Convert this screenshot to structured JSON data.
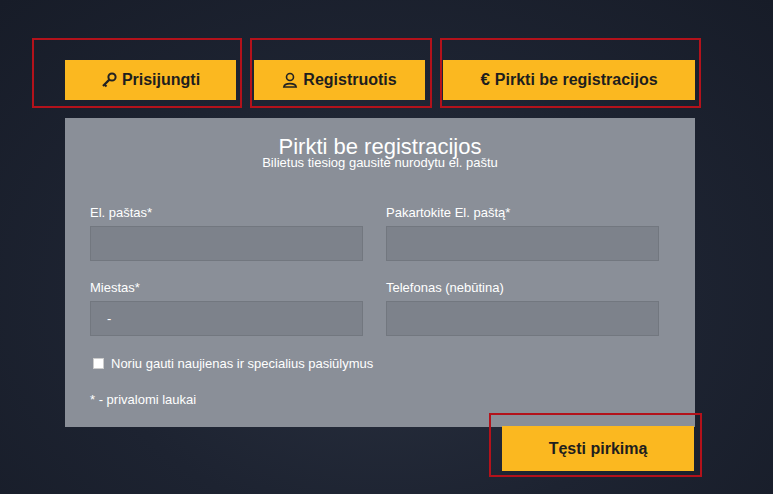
{
  "auth_buttons": [
    {
      "kind": "key",
      "label": "Prisijungti",
      "highlighted": true
    },
    {
      "kind": "user",
      "label": "Registruotis",
      "highlighted": true
    },
    {
      "kind": "glyph",
      "glyph": "€",
      "label": "Pirkti be registracijos",
      "highlighted": true
    }
  ],
  "form": {
    "title": "Pirkti be registracijos",
    "subtitle": "Bilietus tiesiog gausite nurodytu el. paštu",
    "fields": [
      {
        "label": "El. paštas*",
        "value": ""
      },
      {
        "label": "Pakartokite El. paštą*",
        "value": ""
      },
      {
        "label": "Miestas*",
        "value": "-"
      },
      {
        "label": "Telefonas (nebūtina)",
        "value": ""
      }
    ],
    "newsletter": {
      "label": "Noriu gauti naujienas ir specialius pasiūlymus",
      "checked": false
    },
    "note": "* - privalomi laukai",
    "submit": {
      "label": "Tęsti pirkimą",
      "highlighted": true
    }
  }
}
